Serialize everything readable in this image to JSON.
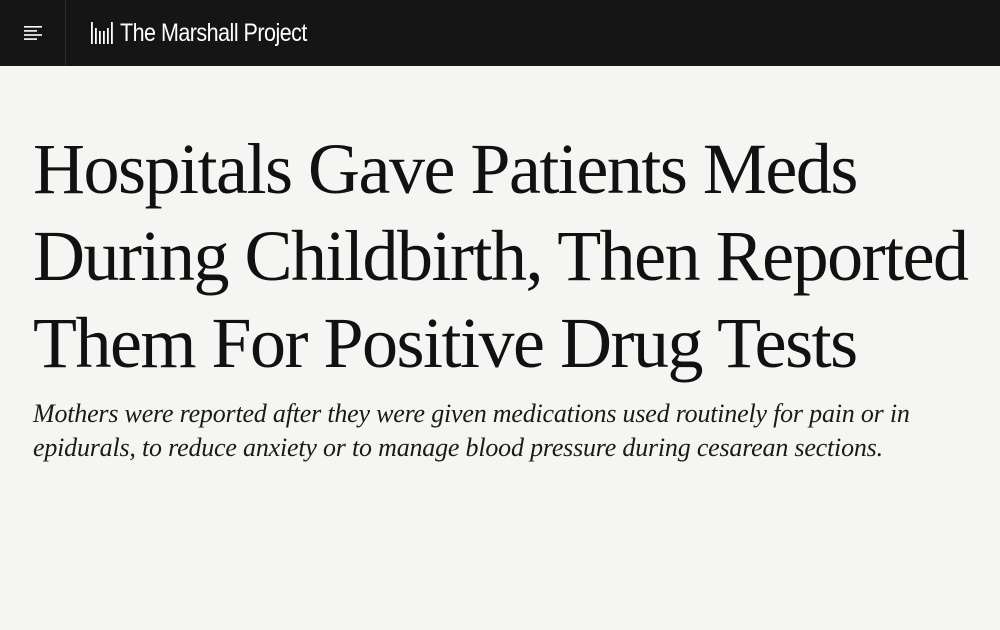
{
  "site": {
    "name": "The Marshall Project",
    "logo_icon": "bars-logo-icon",
    "menu_icon": "hamburger-menu-icon",
    "colors": {
      "topbar": "#151515",
      "background": "#f5f5f3",
      "text": "#111111"
    }
  },
  "article": {
    "headline": "Hospitals Gave Patients Meds During Childbirth, Then Reported Them For Positive Drug Tests",
    "dek": "Mothers were reported after they were given medications used routinely for pain or in epidurals, to reduce anxiety or to manage blood pressure during cesarean sections."
  }
}
